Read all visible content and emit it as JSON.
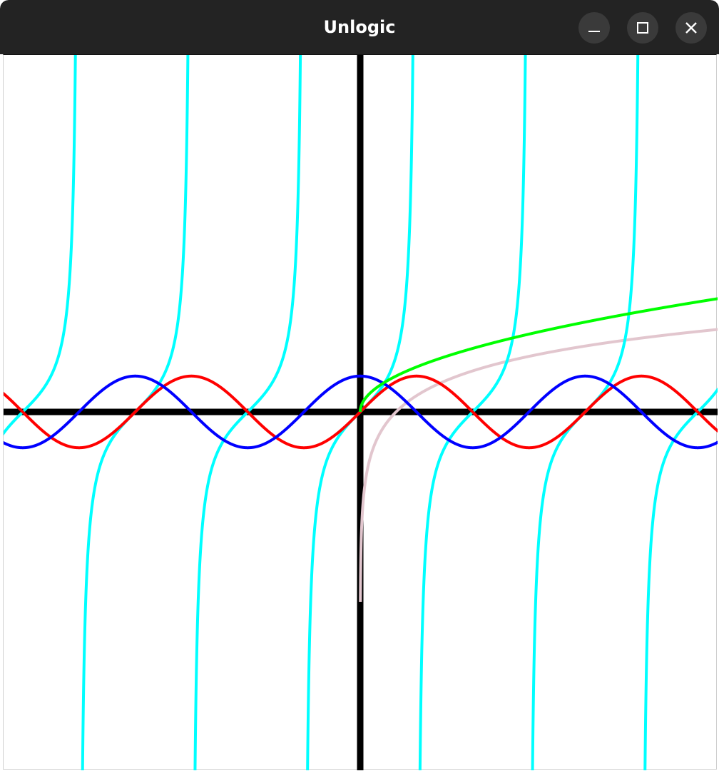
{
  "window": {
    "title": "Unlogic",
    "buttons": [
      "minimize-icon",
      "maximize-icon",
      "close-icon"
    ]
  },
  "chart_data": {
    "type": "line",
    "title": "",
    "xlabel": "",
    "ylabel": "",
    "xlim": [
      -10,
      10
    ],
    "ylim": [
      -10,
      10
    ],
    "grid": false,
    "axes_color": "#000000",
    "series": [
      {
        "fn": "sin",
        "color": "#ff0000",
        "values_sample": {
          "x": [
            -10,
            -5,
            0,
            5,
            10
          ],
          "y": [
            0.544,
            0.959,
            0,
            -0.959,
            -0.544
          ]
        }
      },
      {
        "fn": "cos",
        "color": "#0000ff",
        "values_sample": {
          "x": [
            -10,
            -5,
            0,
            5,
            10
          ],
          "y": [
            -0.839,
            0.284,
            1,
            0.284,
            -0.839
          ]
        }
      },
      {
        "fn": "tan",
        "color": "#00ffff",
        "values_sample": {
          "x": [
            -10,
            -5,
            0,
            5,
            10
          ],
          "y": [
            -0.648,
            3.381,
            0,
            -3.381,
            0.648
          ]
        }
      },
      {
        "fn": "sqrt",
        "color": "#00ff00",
        "values_sample": {
          "x": [
            0,
            1,
            4,
            9,
            10
          ],
          "y": [
            0,
            1,
            2,
            3,
            3.162
          ]
        }
      },
      {
        "fn": "ln",
        "color": "#e2c6ce",
        "values_sample": {
          "x": [
            0.1,
            1,
            5,
            10
          ],
          "y": [
            -2.303,
            0,
            1.609,
            2.303
          ]
        }
      }
    ]
  }
}
